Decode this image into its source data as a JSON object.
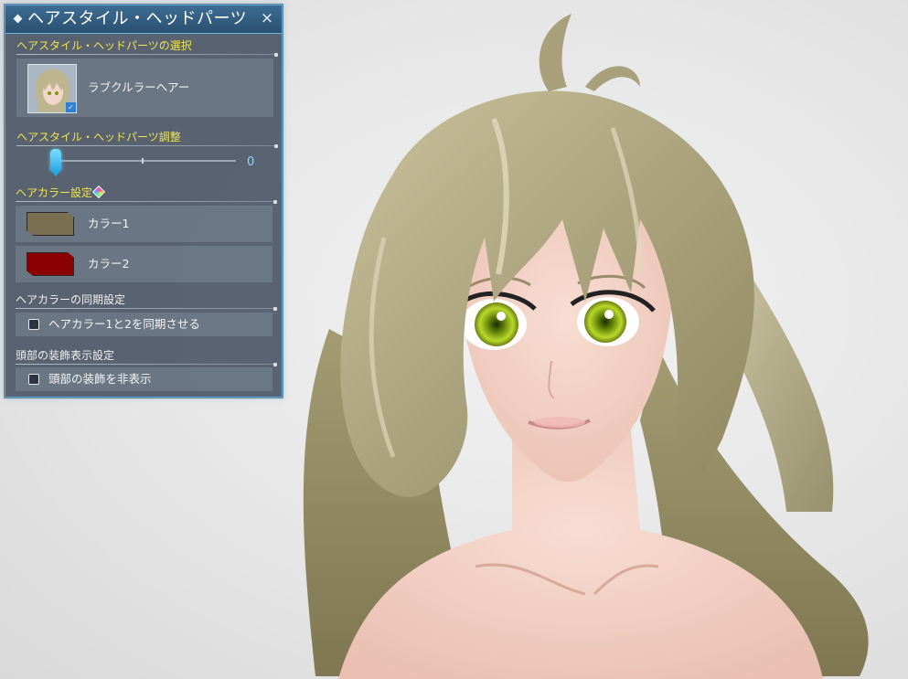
{
  "panel": {
    "title": "ヘアスタイル・ヘッドパーツ",
    "close_icon": "×"
  },
  "selection": {
    "header": "ヘアスタイル・ヘッドパーツの選択",
    "item_name": "ラブクルラーヘアー"
  },
  "adjust": {
    "header": "ヘアスタイル・ヘッドパーツ調整",
    "value": "0"
  },
  "hair_color": {
    "header": "ヘアカラー設定",
    "colors": [
      {
        "label": "カラー1",
        "swatch": "#7a6e50"
      },
      {
        "label": "カラー2",
        "swatch": "#8b0000"
      }
    ]
  },
  "sync": {
    "header": "ヘアカラーの同期設定",
    "checkbox_label": "ヘアカラー1と2を同期させる",
    "checked": false
  },
  "head_accessory": {
    "header": "頭部の装飾表示設定",
    "checkbox_label": "頭部の装飾を非表示",
    "checked": false
  },
  "colors": {
    "panel_border": "#5aa8d8",
    "header_yellow": "#f2e64a",
    "slider_accent": "#29a8e6",
    "hair": "#b7b08c",
    "eyes": "#a6c81e"
  },
  "icons": [
    "diamond-icon",
    "close-icon",
    "rainbow-gem-icon",
    "checkbox"
  ]
}
